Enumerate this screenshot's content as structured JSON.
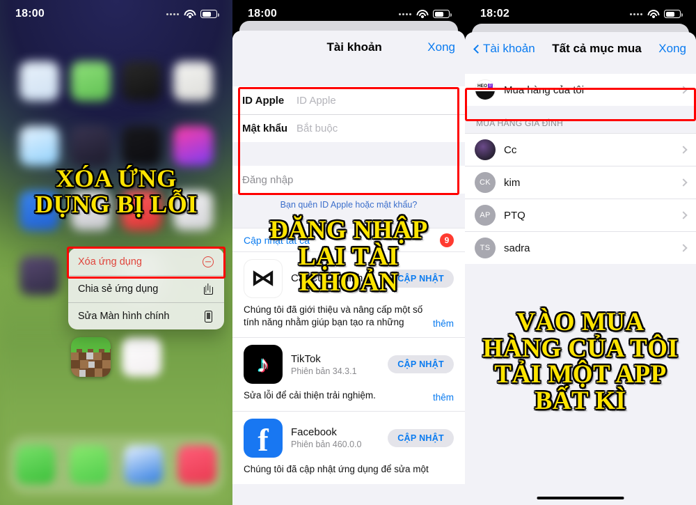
{
  "left": {
    "status": {
      "time": "18:00"
    },
    "caption": [
      "XÓA ỨNG",
      "DỤNG BỊ LỖI"
    ],
    "context_menu": [
      {
        "label": "Xóa ứng dụng",
        "icon": "minus-circle-icon",
        "danger": true
      },
      {
        "label": "Chia sẻ ứng dụng",
        "icon": "share-icon",
        "danger": false
      },
      {
        "label": "Sửa Màn hình chính",
        "icon": "phone-icon",
        "danger": false
      }
    ]
  },
  "middle": {
    "status": {
      "time": "18:00"
    },
    "nav": {
      "title": "Tài khoản",
      "right": "Xong"
    },
    "form": {
      "apple_id_label": "ID Apple",
      "apple_id_placeholder": "ID Apple",
      "password_label": "Mật khẩu",
      "password_placeholder": "Bắt buộc",
      "signin": "Đăng nhập",
      "forgot": "Bạn quên ID Apple hoặc mật khẩu?"
    },
    "updates": {
      "update_all": "Cập nhật tất cả",
      "badge": "9",
      "apps": [
        {
          "name": "CapCut - Chỉnh ...",
          "version": "",
          "button": "CẬP NHẬT",
          "desc": "Chúng tôi đã giới thiệu và nâng cấp một số tính năng nhằm giúp bạn tạo ra những",
          "more": "thêm",
          "icon": "capcut-icon"
        },
        {
          "name": "TikTok",
          "version": "Phiên bản 34.3.1",
          "button": "CẬP NHẬT",
          "desc": "Sửa lỗi để cải thiện trải nghiệm.",
          "more": "thêm",
          "icon": "tiktok-icon"
        },
        {
          "name": "Facebook",
          "version": "Phiên bản 460.0.0",
          "button": "CẬP NHẬT",
          "desc": "Chúng tôi đã cập nhật ứng dụng để sửa một",
          "more": "",
          "icon": "facebook-icon"
        }
      ]
    },
    "caption": [
      "ĐĂNG NHẬP",
      "LẠI TÀI",
      "KHOẢN"
    ]
  },
  "right": {
    "status": {
      "time": "18:02"
    },
    "nav": {
      "back": "Tài khoản",
      "title": "Tất cả mục mua",
      "right": "Xong"
    },
    "my_purchases": {
      "label": "Mua hàng của tôi",
      "icon": "heo-avatar"
    },
    "section_header": "MUA HÀNG GIA ĐÌNH",
    "family": [
      {
        "name": "Cc",
        "initials": "",
        "photo": true
      },
      {
        "name": "kim",
        "initials": "CK",
        "photo": false
      },
      {
        "name": "PTQ",
        "initials": "AP",
        "photo": false
      },
      {
        "name": "sadra",
        "initials": "TS",
        "photo": false
      }
    ],
    "caption": [
      "VÀO MUA",
      "HÀNG CỦA TÔI",
      "TẢI MỘT APP",
      "BẤT KÌ"
    ]
  },
  "colors": {
    "highlight": "#ff0000",
    "accent_blue": "#0a7bf0",
    "caption_yellow": "#ffe400",
    "badge_red": "#ff3b30"
  }
}
